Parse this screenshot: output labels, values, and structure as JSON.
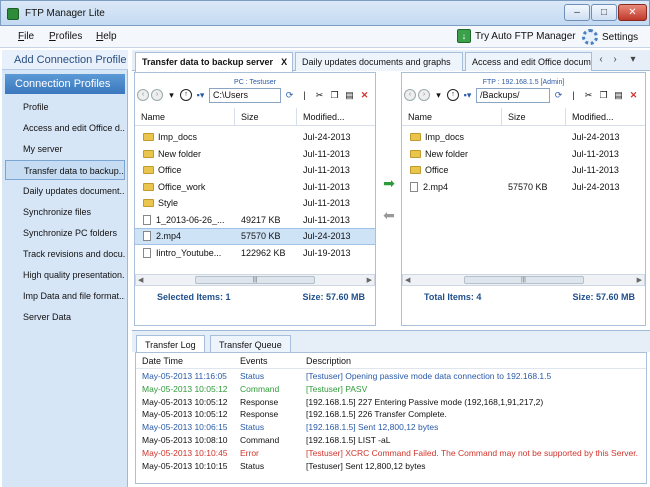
{
  "window": {
    "title": "FTP Manager Lite"
  },
  "menu": {
    "file": "File",
    "profiles": "Profiles",
    "help": "Help"
  },
  "toolbar": {
    "try_auto": "Try Auto FTP Manager",
    "settings": "Settings"
  },
  "sidebar": {
    "add_profile": "Add Connection Profile",
    "header": "Connection Profiles",
    "items": [
      "Profile",
      "Access and edit Office d...",
      "My server",
      "Transfer data to backup...",
      "Daily updates document...",
      "Synchronize files",
      "Synchronize PC folders",
      "Track revisions and docu...",
      "High quality presentation...",
      "Imp Data and file format...",
      "Server Data"
    ],
    "selected_index": 3
  },
  "tabs": [
    {
      "label": "Transfer data to backup server",
      "close": "X"
    },
    {
      "label": "Daily updates documents and graphs"
    },
    {
      "label": "Access and edit Office docum"
    }
  ],
  "tab_nav": {
    "prev": "‹",
    "next": "›",
    "menu": "▾"
  },
  "left_pane": {
    "title": "PC : Testuser",
    "path": "C:\\Users",
    "columns": {
      "name": "Name",
      "size": "Size",
      "modified": "Modified..."
    },
    "files": [
      {
        "name": "Imp_docs",
        "size": "",
        "modified": "Jul-24-2013",
        "type": "folder"
      },
      {
        "name": "New folder",
        "size": "",
        "modified": "Jul-11-2013",
        "type": "folder"
      },
      {
        "name": "Office",
        "size": "",
        "modified": "Jul-11-2013",
        "type": "folder"
      },
      {
        "name": "Office_work",
        "size": "",
        "modified": "Jul-11-2013",
        "type": "folder"
      },
      {
        "name": "Style",
        "size": "",
        "modified": "Jul-11-2013",
        "type": "folder"
      },
      {
        "name": "1_2013-06-26_...",
        "size": "49217 KB",
        "modified": "Jul-11-2013",
        "type": "file"
      },
      {
        "name": "2.mp4",
        "size": "57570 KB",
        "modified": "Jul-24-2013",
        "type": "file"
      },
      {
        "name": "Iintro_Youtube...",
        "size": "122962 KB",
        "modified": "Jul-19-2013",
        "type": "file"
      }
    ],
    "selected_index": 6,
    "status_left": "Selected Items: 1",
    "status_right": "Size: 57.60 MB"
  },
  "right_pane": {
    "title": "FTP : 192.168.1.5 [Admin]",
    "path": "/Backups/",
    "columns": {
      "name": "Name",
      "size": "Size",
      "modified": "Modified..."
    },
    "files": [
      {
        "name": "Imp_docs",
        "size": "",
        "modified": "Jul-24-2013",
        "type": "folder"
      },
      {
        "name": "New folder",
        "size": "",
        "modified": "Jul-11-2013",
        "type": "folder"
      },
      {
        "name": "Office",
        "size": "",
        "modified": "Jul-11-2013",
        "type": "folder"
      },
      {
        "name": "2.mp4",
        "size": "57570 KB",
        "modified": "Jul-24-2013",
        "type": "file"
      }
    ],
    "status_left": "Total Items: 4",
    "status_right": "Size: 57.60 MB"
  },
  "log_tabs": {
    "log": "Transfer Log",
    "queue": "Transfer Queue"
  },
  "log": {
    "columns": {
      "time": "Date Time",
      "event": "Events",
      "desc": "Description"
    },
    "rows": [
      {
        "time": "May-05-2013 11:16:05",
        "event": "Status",
        "desc": "[Testuser] Opening passive mode data connection to 192.168.1.5",
        "color": "#2a5aa8"
      },
      {
        "time": "May-05-2013 10:05:12",
        "event": "Command",
        "desc": "[Testuser] PASV",
        "color": "#2f9a3a"
      },
      {
        "time": "May-05-2013 10:05:12",
        "event": "Response",
        "desc": "[192.168.1.5] 227 Entering Passive mode (192,168,1,91,217,2)",
        "color": "#111111"
      },
      {
        "time": "May-05-2013 10:05:12",
        "event": "Response",
        "desc": "[192.168.1.5] 226 Transfer Complete.",
        "color": "#111111"
      },
      {
        "time": "May-05-2013 10:06:15",
        "event": "Status",
        "desc": "[192.168.1.5] Sent 12,800,12 bytes",
        "color": "#2a5aa8"
      },
      {
        "time": "May-05-2013 10:08:10",
        "event": "Command",
        "desc": "[192.168.1.5] LIST -aL",
        "color": "#111111"
      },
      {
        "time": "May-05-2013 10:10:45",
        "event": "Error",
        "desc": "[Testuser] XCRC Command Failed. The Command may not be supported by this Server.",
        "color": "#d0342c"
      },
      {
        "time": "May-05-2013 10:10:15",
        "event": "Status",
        "desc": "[Testuser] Sent 12,800,12 bytes",
        "color": "#111111"
      }
    ]
  }
}
